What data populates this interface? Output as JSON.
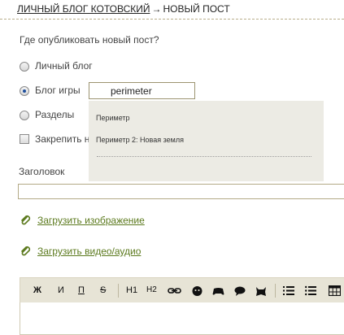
{
  "breadcrumb": {
    "blog": "ЛИЧНЫЙ БЛОГ КОТОВСКИЙ",
    "arrow": "→",
    "current": "НОВЫЙ ПОСТ"
  },
  "question": "Где опубликовать новый пост?",
  "options": {
    "personal": "Личный блог",
    "game": "Блог игры",
    "sections": "Разделы",
    "pin": "Закрепить н"
  },
  "game_input": {
    "value": "perimeter"
  },
  "dropdown": {
    "items": [
      "Периметр",
      "Периметр 2: Новая земля"
    ]
  },
  "title_label": "Заголовок",
  "upload_image": "Загрузить изображение",
  "upload_video": "Загрузить видео/аудио",
  "toolbar": {
    "bold": "Ж",
    "italic": "И",
    "underline": "П",
    "strike": "S",
    "h1": "H1",
    "h2": "H2"
  },
  "colors": {
    "link": "#5c7a1e",
    "toolbar_bg": "#e7e4d6",
    "dropdown_bg": "#ecebe4"
  }
}
